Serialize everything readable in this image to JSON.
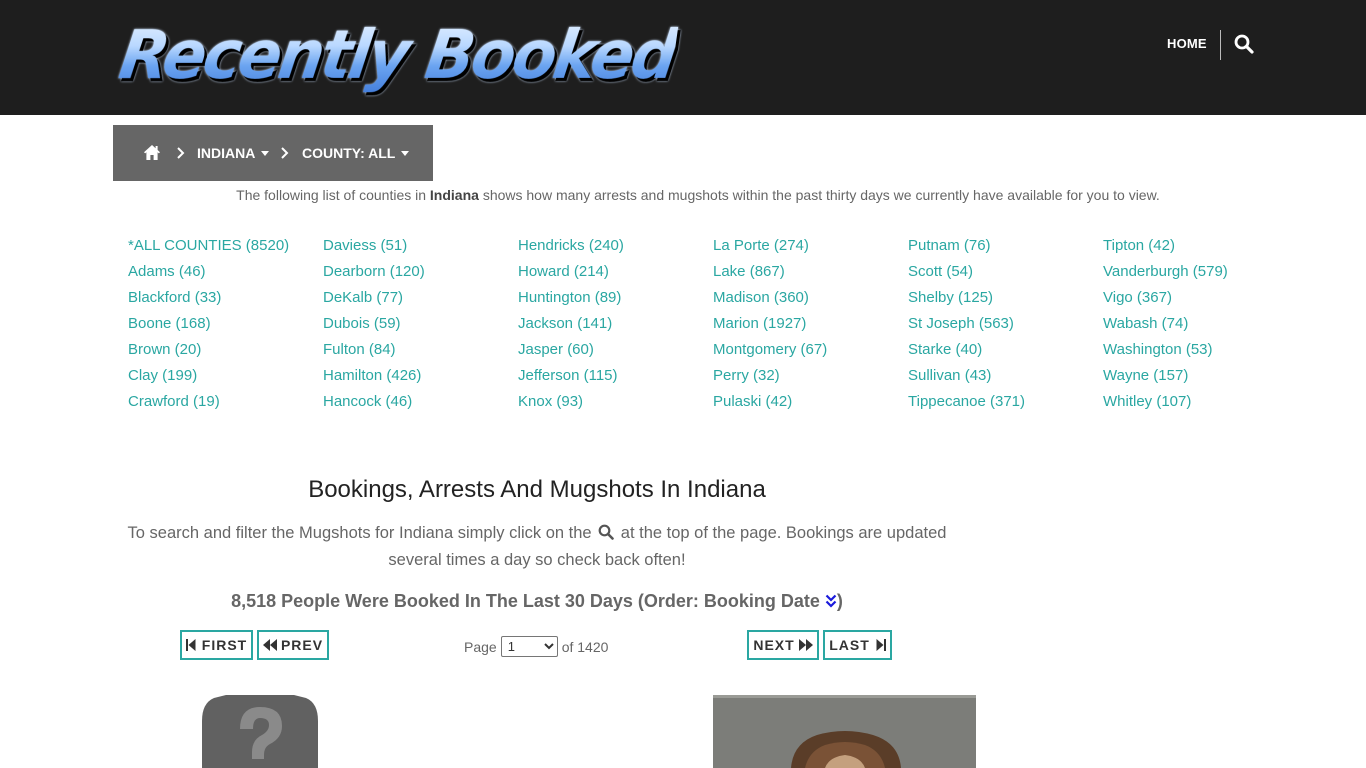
{
  "header": {
    "logo_text": "Recently Booked",
    "nav_home": "HOME",
    "search_icon": "search-icon"
  },
  "breadcrumb": {
    "home_icon": "home-icon",
    "state": "INDIANA",
    "county": "COUNTY: ALL"
  },
  "intro": {
    "before": "The following list of counties in ",
    "state": "Indiana",
    "after": " shows how many arrests and mugshots within the past thirty days we currently have available for you to view."
  },
  "counties": [
    "*ALL COUNTIES (8520)",
    "Adams (46)",
    "Blackford (33)",
    "Boone (168)",
    "Brown (20)",
    "Clay (199)",
    "Crawford (19)",
    "Daviess (51)",
    "Dearborn (120)",
    "DeKalb (77)",
    "Dubois (59)",
    "Fulton (84)",
    "Hamilton (426)",
    "Hancock (46)",
    "Hendricks (240)",
    "Howard (214)",
    "Huntington (89)",
    "Jackson (141)",
    "Jasper (60)",
    "Jefferson (115)",
    "Knox (93)",
    "La Porte (274)",
    "Lake (867)",
    "Madison (360)",
    "Marion (1927)",
    "Montgomery (67)",
    "Perry (32)",
    "Pulaski (42)",
    "Putnam (76)",
    "Scott (54)",
    "Shelby (125)",
    "St Joseph (563)",
    "Starke (40)",
    "Sullivan (43)",
    "Tippecanoe (371)",
    "Tipton (42)",
    "Vanderburgh (579)",
    "Vigo (367)",
    "Wabash (74)",
    "Washington (53)",
    "Wayne (157)",
    "Whitley (107)"
  ],
  "section": {
    "title": "Bookings, Arrests And Mugshots In Indiana",
    "desc_before": "To search and filter the Mugshots for Indiana simply click on the",
    "desc_after": " at the top of the page. Bookings are updated several times a day so check back often!",
    "booked_text": "8,518 People Were Booked In The Last 30 Days (Order: Booking Date ",
    "booked_close": ")"
  },
  "pagination": {
    "first": "FIRST",
    "prev": "PREV",
    "next": "NEXT",
    "last": "LAST",
    "page_label": "Page",
    "current_page": "1",
    "of_label": "of 1420"
  },
  "colors": {
    "accent": "#2aa7a2",
    "header_bg": "#1e1e1e",
    "breadcrumb_bg": "#666666"
  }
}
